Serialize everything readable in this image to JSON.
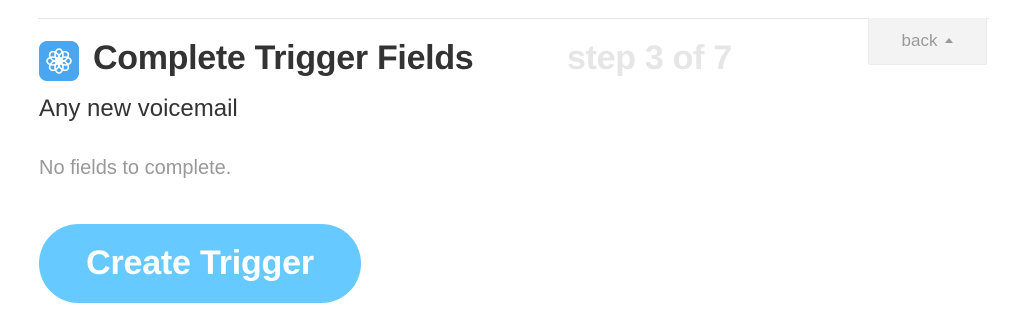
{
  "header": {
    "title": "Complete Trigger Fields",
    "step_text": "step 3 of 7",
    "back_label": "back",
    "service_icon": "voicemail-flower-icon",
    "service_icon_color": "#4aa6ee"
  },
  "trigger": {
    "name": "Any new voicemail",
    "fields_message": "No fields to complete."
  },
  "actions": {
    "create_label": "Create Trigger",
    "create_color": "#66c9ff"
  }
}
